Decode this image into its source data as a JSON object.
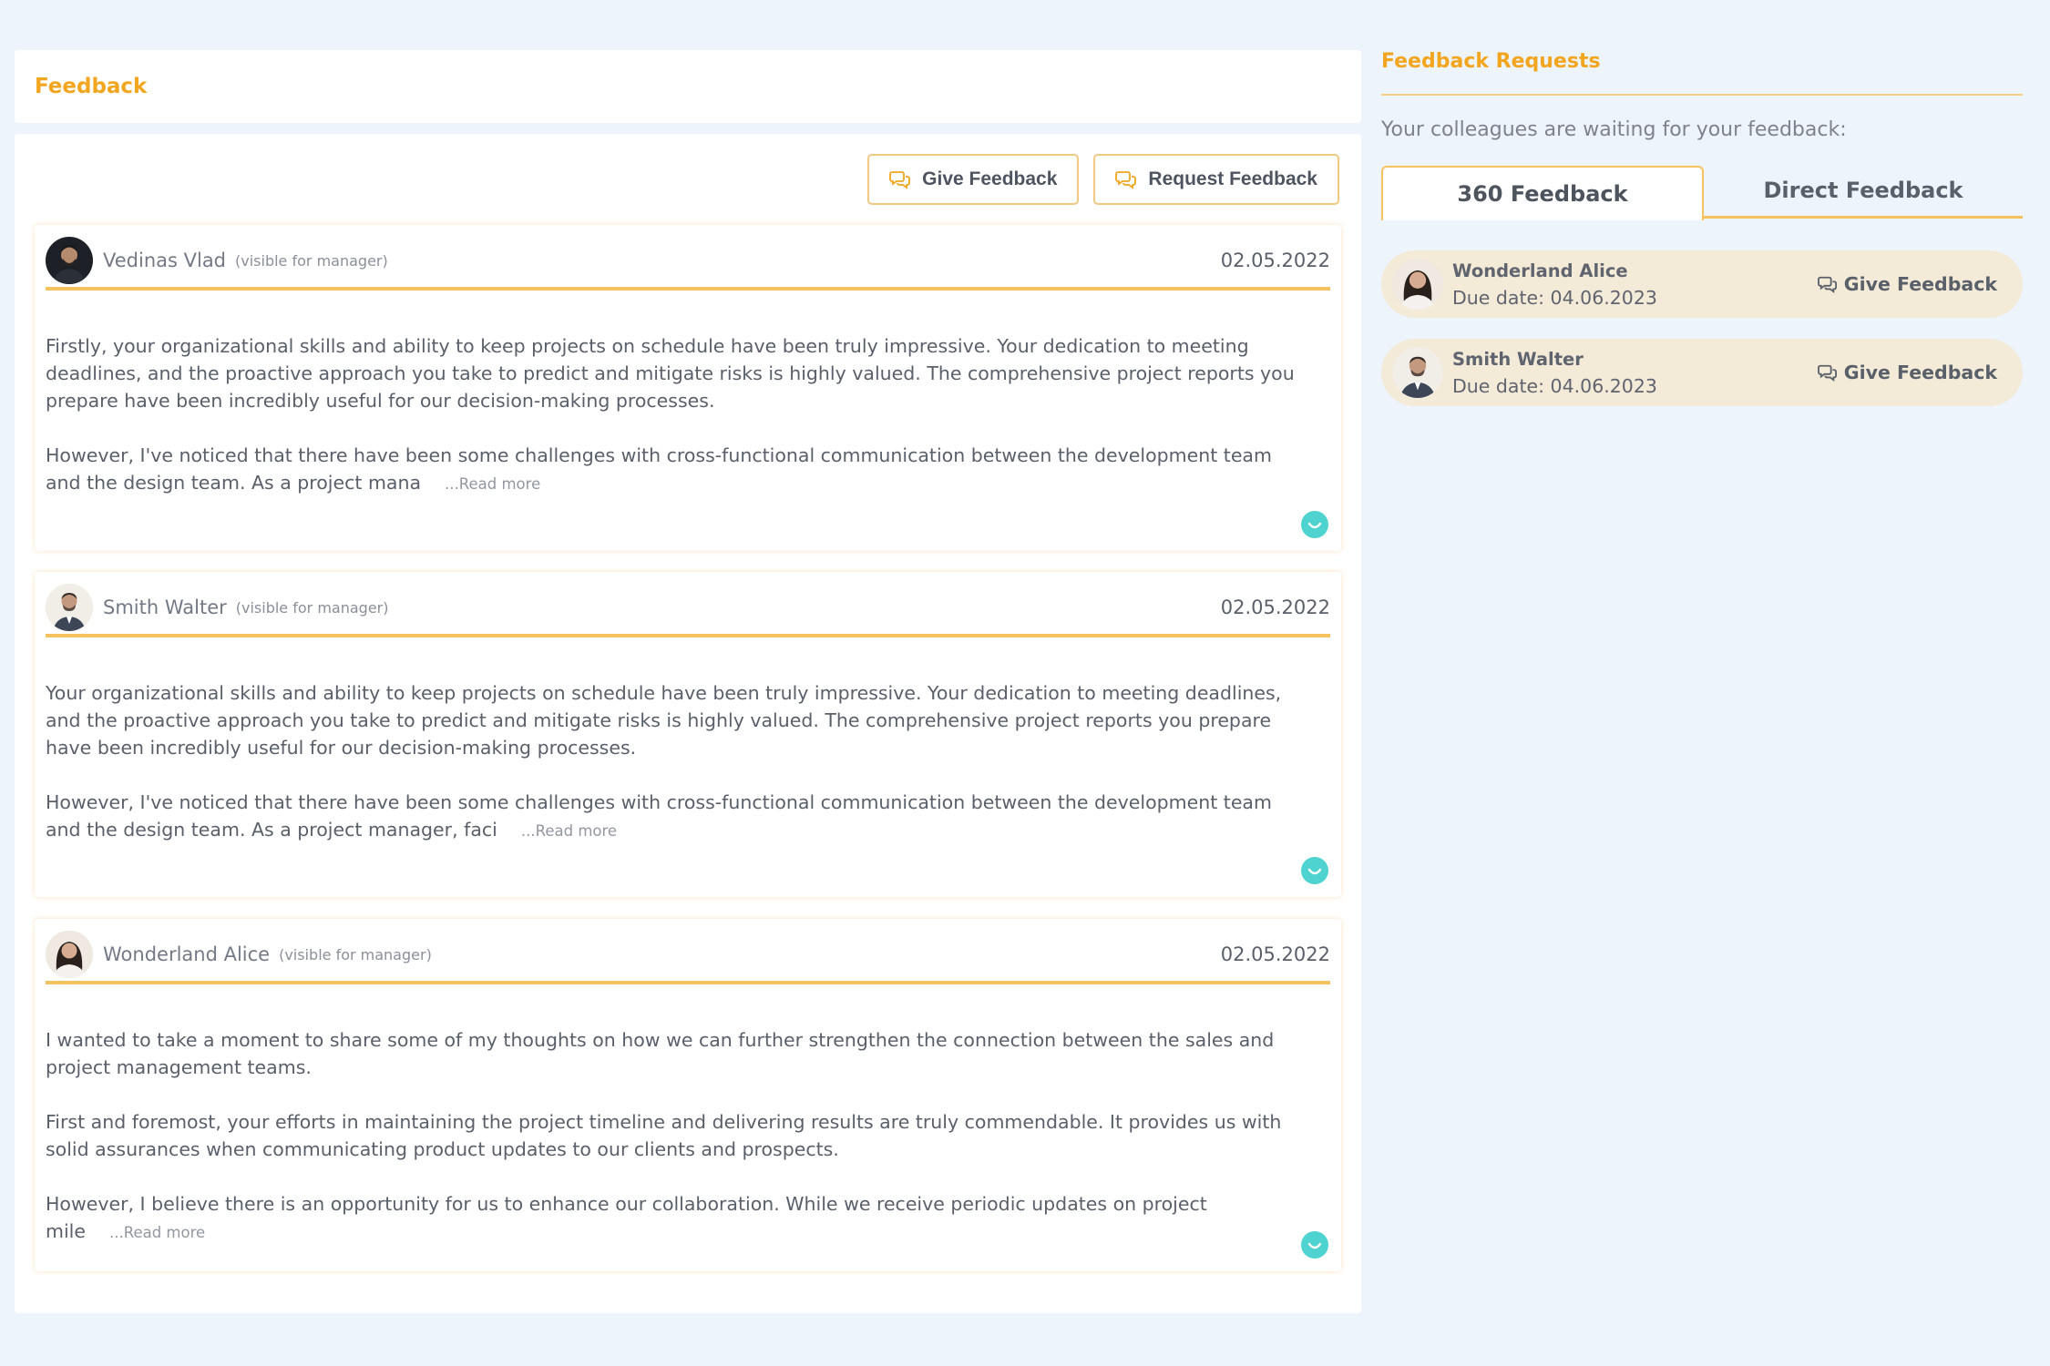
{
  "header": {
    "title": "Feedback"
  },
  "actions": {
    "give_label": "Give Feedback",
    "request_label": "Request Feedback"
  },
  "feedbacks": [
    {
      "name": "Vedinas Vlad",
      "visibility": "(visible for manager)",
      "date": "02.05.2022",
      "paragraphs": [
        "Firstly, your organizational skills and ability to keep projects on schedule have been truly impressive. Your dedication to meeting deadlines, and the proactive approach you take to predict and mitigate risks is highly valued. The comprehensive project reports you prepare have been incredibly useful for our decision-making processes.",
        "However, I've noticed that there have been some challenges with cross-functional communication between the development team and the design team. As a project mana"
      ],
      "read_more": "...Read more"
    },
    {
      "name": "Smith Walter",
      "visibility": "(visible for manager)",
      "date": "02.05.2022",
      "paragraphs": [
        "Your organizational skills and ability to keep projects on schedule have been truly impressive. Your dedication to meeting deadlines, and the proactive approach you take to predict and mitigate risks is highly valued. The comprehensive project reports you prepare have been incredibly useful for our decision-making processes.",
        "However, I've noticed that there have been some challenges with cross-functional communication between the development team and the design team. As a project manager, faci"
      ],
      "read_more": "...Read more"
    },
    {
      "name": "Wonderland Alice",
      "visibility": "(visible for manager)",
      "date": "02.05.2022",
      "paragraphs": [
        "I wanted to take a moment to share some of my thoughts on how we can further strengthen the connection between the sales and project management teams.",
        "First and foremost, your efforts in maintaining the project timeline and delivering results are truly commendable. It provides us with solid assurances when communicating product updates to our clients and prospects.",
        "However, I believe there is an opportunity for us to enhance our collaboration. While we receive periodic updates on project mile"
      ],
      "read_more": "...Read more"
    }
  ],
  "requests": {
    "title": "Feedback Requests",
    "subtitle": "Your colleagues are waiting for your feedback:",
    "tabs": [
      "360 Feedback",
      "Direct Feedback"
    ],
    "items": [
      {
        "name": "Wonderland Alice",
        "due": "Due date: 04.06.2023",
        "action": "Give Feedback"
      },
      {
        "name": "Smith Walter",
        "due": "Due date: 04.06.2023",
        "action": "Give Feedback"
      }
    ]
  },
  "colors": {
    "accent": "#f2a51e",
    "divider": "#f4c25e",
    "request_bg": "#f4ead8",
    "smile": "#4fd3d0",
    "page_bg": "#eef4fc"
  },
  "icons": {
    "actions": "chat-bubbles-icon",
    "avatar": "avatar",
    "reaction": "smile-icon"
  }
}
